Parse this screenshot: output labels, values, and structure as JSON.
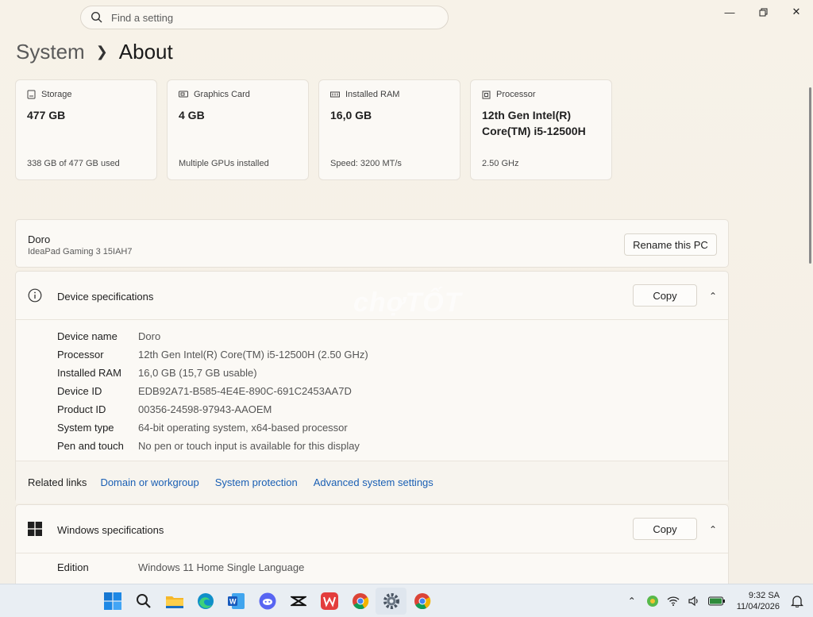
{
  "search": {
    "placeholder": "Find a setting"
  },
  "breadcrumb": {
    "parent": "System",
    "current": "About"
  },
  "cards": [
    {
      "label": "Storage",
      "value": "477 GB",
      "sub": "338 GB of 477 GB used",
      "icon": "storage-icon"
    },
    {
      "label": "Graphics Card",
      "value": "4 GB",
      "sub": "Multiple GPUs installed",
      "icon": "graphics-card-icon"
    },
    {
      "label": "Installed RAM",
      "value": "16,0 GB",
      "sub": "Speed: 3200 MT/s",
      "icon": "ram-icon"
    },
    {
      "label": "Processor",
      "value": "12th Gen Intel(R) Core(TM) i5-12500H",
      "sub": "2.50 GHz",
      "icon": "processor-icon"
    }
  ],
  "pc": {
    "name": "Doro",
    "model": "IdeaPad Gaming 3 15IAH7",
    "rename_label": "Rename this PC"
  },
  "device_specs": {
    "title": "Device specifications",
    "copy_label": "Copy",
    "rows": [
      {
        "key": "Device name",
        "value": "Doro"
      },
      {
        "key": "Processor",
        "value": "12th Gen Intel(R) Core(TM) i5-12500H (2.50 GHz)"
      },
      {
        "key": "Installed RAM",
        "value": "16,0 GB (15,7 GB usable)"
      },
      {
        "key": "Device ID",
        "value": "EDB92A71-B585-4E4E-890C-691C2453AA7D"
      },
      {
        "key": "Product ID",
        "value": "00356-24598-97943-AAOEM"
      },
      {
        "key": "System type",
        "value": "64-bit operating system, x64-based processor"
      },
      {
        "key": "Pen and touch",
        "value": "No pen or touch input is available for this display"
      }
    ]
  },
  "related": {
    "label": "Related links",
    "links": [
      "Domain or workgroup",
      "System protection",
      "Advanced system settings"
    ]
  },
  "windows_specs": {
    "title": "Windows specifications",
    "copy_label": "Copy",
    "rows": [
      {
        "key": "Edition",
        "value": "Windows 11 Home Single Language"
      }
    ]
  },
  "watermark": "chợTỐT",
  "taskbar": {
    "apps": [
      "windows-start-icon",
      "search-icon",
      "file-explorer-icon",
      "edge-icon",
      "word-icon",
      "discord-icon",
      "capcut-icon",
      "wps-icon",
      "chrome-icon",
      "settings-icon",
      "chrome-profile-icon"
    ],
    "time": "9:32 SA",
    "date": "11/04/2026"
  },
  "colors": {
    "accent": "#1a5fb4",
    "background": "#f6f1e6"
  }
}
